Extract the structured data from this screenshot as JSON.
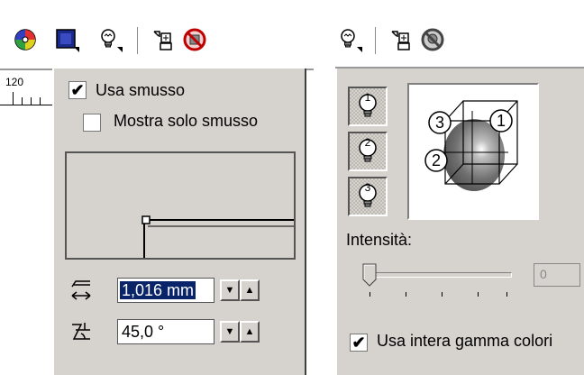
{
  "left": {
    "toolbar": {
      "icons": [
        "color-wheel-icon",
        "frame-box-icon",
        "lightbulb-icon",
        "copy-properties-icon",
        "no-bevel-icon"
      ]
    },
    "ruler": {
      "label": "120"
    },
    "bevel": {
      "use_bevel_label": "Usa smusso",
      "use_bevel_checked": true,
      "show_only_bevel_label": "Mostra solo smusso",
      "show_only_bevel_checked": false
    },
    "bevel_width": {
      "value": "1,016 mm"
    },
    "bevel_angle": {
      "value": "45,0 °"
    }
  },
  "right": {
    "toolbar": {
      "icons": [
        "lightbulb-icon",
        "copy-properties-icon",
        "no-light-icon"
      ]
    },
    "lights": [
      {
        "label": "1"
      },
      {
        "label": "2"
      },
      {
        "label": "3"
      }
    ],
    "preview": {
      "markers": [
        "3",
        "1",
        "2"
      ]
    },
    "intensity_label": "Intensità:",
    "intensity_value": "0",
    "intensity_level": 0,
    "full_color_label": "Usa intera gamma colori",
    "full_color_checked": true
  },
  "colors": {
    "panel": "#d6d3ce",
    "selection": "#0a246a"
  }
}
